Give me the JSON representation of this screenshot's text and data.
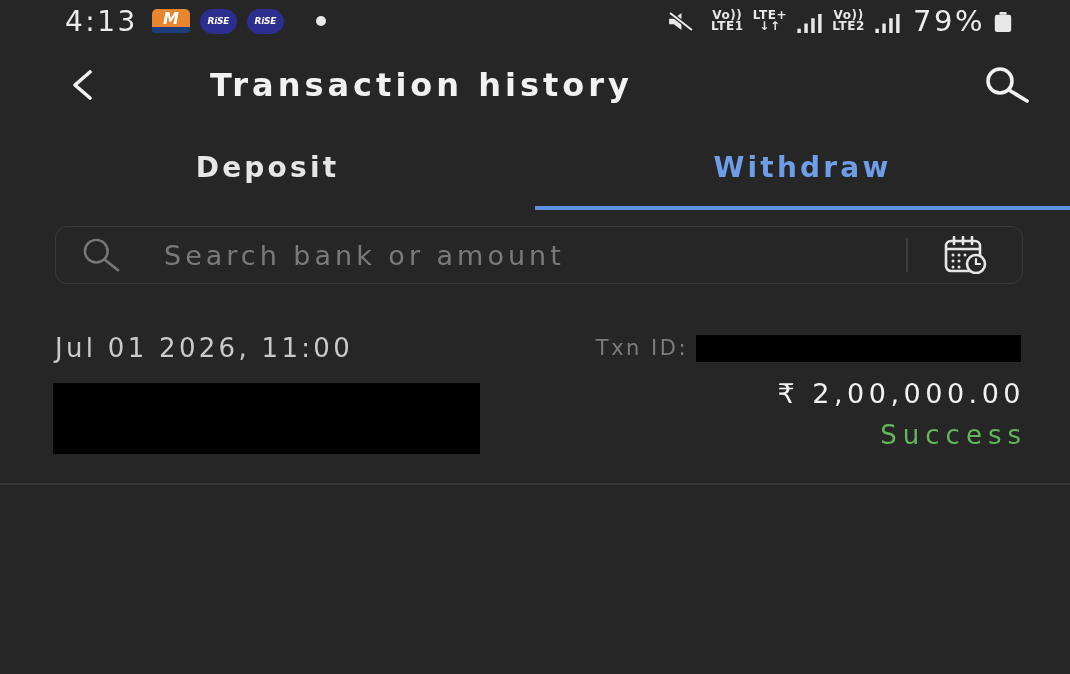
{
  "status_bar": {
    "time": "4:13",
    "app_icons": [
      {
        "kind": "mstock",
        "label": "M"
      },
      {
        "kind": "rise",
        "label": "RiSE"
      },
      {
        "kind": "rise",
        "label": "RiSE"
      }
    ],
    "network": [
      {
        "kind": "label",
        "top": "Vo))",
        "bottom": "LTE1"
      },
      {
        "kind": "label",
        "top": "LTE+",
        "bottom": "↓↑"
      },
      {
        "kind": "signal"
      },
      {
        "kind": "label",
        "top": "Vo))",
        "bottom": "LTE2"
      },
      {
        "kind": "signal"
      }
    ],
    "battery": "79%"
  },
  "header": {
    "title": "Transaction history"
  },
  "tabs": [
    {
      "label": "Deposit",
      "selected": false
    },
    {
      "label": "Withdraw",
      "selected": true
    }
  ],
  "search": {
    "placeholder": "Search bank or amount"
  },
  "transactions": [
    {
      "datetime": "Jul 01 2026, 11:00",
      "txn_id_label": "Txn ID:",
      "txn_id_redacted": true,
      "bank_redacted": true,
      "amount": "₹ 2,00,000.00",
      "status": {
        "text": "Success",
        "color": "#63b65c"
      }
    }
  ]
}
